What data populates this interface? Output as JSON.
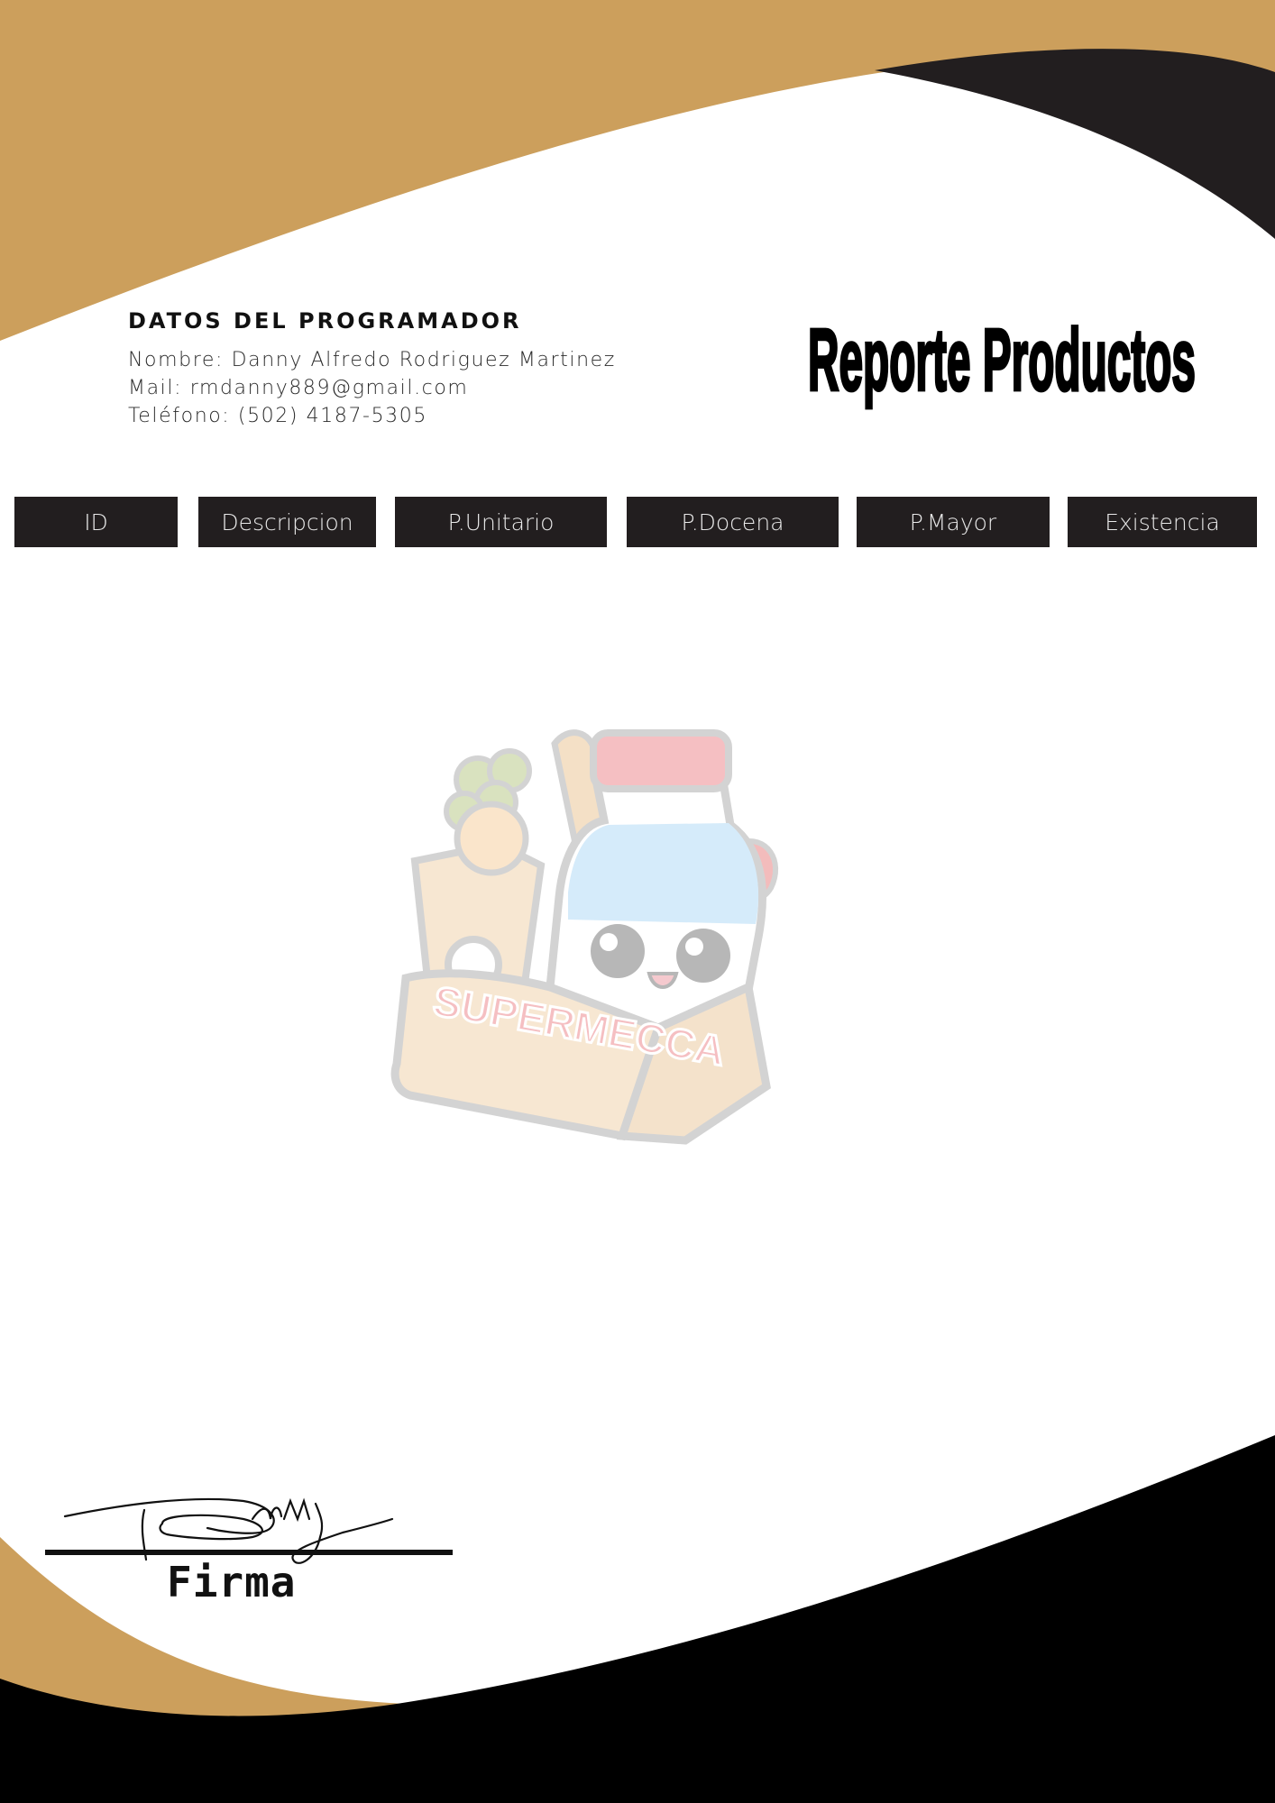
{
  "colors": {
    "accent_gold": "#cc9f5c",
    "dark": "#221e1f",
    "black": "#000000"
  },
  "developer": {
    "heading": "DATOS DEL PROGRAMADOR",
    "name_line": "Nombre: Danny Alfredo Rodriguez Martinez",
    "mail_line": "Mail: rmdanny889@gmail.com",
    "phone_line": "Teléfono: (502) 4187-5305"
  },
  "report": {
    "title": "Reporte Productos"
  },
  "table": {
    "columns": [
      "ID",
      "Descripcion",
      "P.Unitario",
      "P.Docena",
      "P.Mayor",
      "Existencia"
    ]
  },
  "watermark": {
    "logo_text": "SUPERMECCA",
    "icon": "grocery-bag-mascot-icon"
  },
  "signature": {
    "handwriting": "Danny",
    "label": "Firma"
  }
}
